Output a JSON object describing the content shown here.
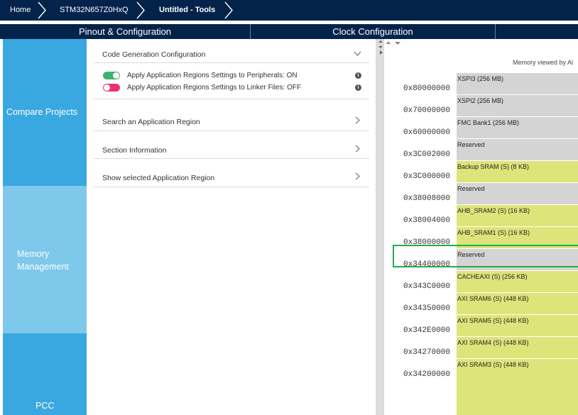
{
  "breadcrumb": {
    "home": "Home",
    "device": "STM32N657Z0HxQ",
    "project": "Untitled - Tools"
  },
  "tabs": {
    "pinout": "Pinout & Configuration",
    "clock": "Clock Configuration"
  },
  "sidebar": {
    "compare": "Compare Projects",
    "memory_line1": "Memory",
    "memory_line2": "Management",
    "pcc": "PCC"
  },
  "panel": {
    "code_gen": "Code Generation Configuration",
    "toggle_peripherals": "Apply Application Regions Settings to Peripherals: ON",
    "toggle_linker": "Apply Application Regions Settings to Linker Files: OFF",
    "search_region": "Search an Application Region",
    "section_info": "Section Information",
    "show_region": "Show selected Application Region"
  },
  "memory": {
    "header": "Memory viewed by Al",
    "rows": [
      {
        "addr": "0x80000000",
        "label": "XSPI3 (256 MB)",
        "kind": "reserved"
      },
      {
        "addr": "0x70000000",
        "label": "XSPI2 (256 MB)",
        "kind": "reserved"
      },
      {
        "addr": "0x60000000",
        "label": "FMC Bank1 (256 MB)",
        "kind": "reserved"
      },
      {
        "addr": "0x3C002000",
        "label": "Reserved",
        "kind": "reserved"
      },
      {
        "addr": "0x3C000000",
        "label": "Backup SRAM (S) (8 KB)",
        "kind": "ram"
      },
      {
        "addr": "0x38008000",
        "label": "Reserved",
        "kind": "reserved"
      },
      {
        "addr": "0x38004000",
        "label": "AHB_SRAM2 (S) (16 KB)",
        "kind": "ram"
      },
      {
        "addr": "0x38000000",
        "label": "AHB_SRAM1 (S) (16 KB)",
        "kind": "ram"
      },
      {
        "addr": "0x34400000",
        "label": "Reserved",
        "kind": "reserved"
      },
      {
        "addr": "0x343C0000",
        "label": "CACHEAXI (S) (256 KB)",
        "kind": "ram"
      },
      {
        "addr": "0x34350000",
        "label": "AXI SRAM6 (S) (448 KB)",
        "kind": "ram"
      },
      {
        "addr": "0x342E0000",
        "label": "AXI SRAM5 (S) (448 KB)",
        "kind": "ram"
      },
      {
        "addr": "0x34270000",
        "label": "AXI SRAM4 (S) (448 KB)",
        "kind": "ram"
      },
      {
        "addr": "0x34200000",
        "label": "AXI SRAM3 (S) (448 KB)",
        "kind": "ram"
      }
    ]
  },
  "colors": {
    "navy": "#03234b",
    "sidebar_blue": "#3aa8e0",
    "sidebar_light": "#7ec8ec",
    "toggle_on": "#3cb371",
    "toggle_off": "#e8336d",
    "reserved_gray": "#d4d4d4",
    "ram_yellow": "#dde57a",
    "highlight": "#27a94f"
  }
}
